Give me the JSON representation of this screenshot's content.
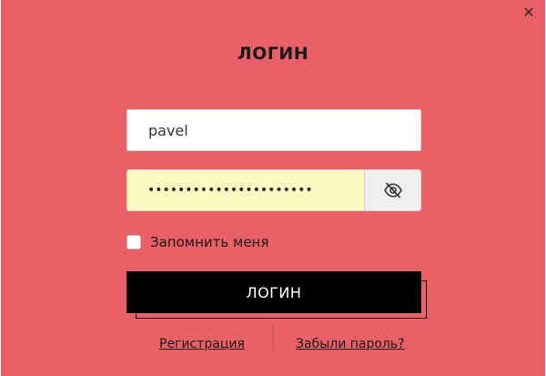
{
  "modal": {
    "title": "ЛОГИН",
    "close_symbol": "✕"
  },
  "form": {
    "username_value": "pavel",
    "password_value": "••••••••••••••••••••••",
    "remember_label": "Запомнить меня",
    "remember_checked": false,
    "submit_label": "ЛОГИН"
  },
  "links": {
    "register": "Регистрация",
    "forgot": "Забыли пароль?"
  },
  "icons": {
    "close": "close-icon",
    "toggle_password": "eye-slash-icon"
  },
  "colors": {
    "modal_bg": "#e96066",
    "button_bg": "#000000",
    "password_autofill_bg": "#fbfbc0"
  }
}
